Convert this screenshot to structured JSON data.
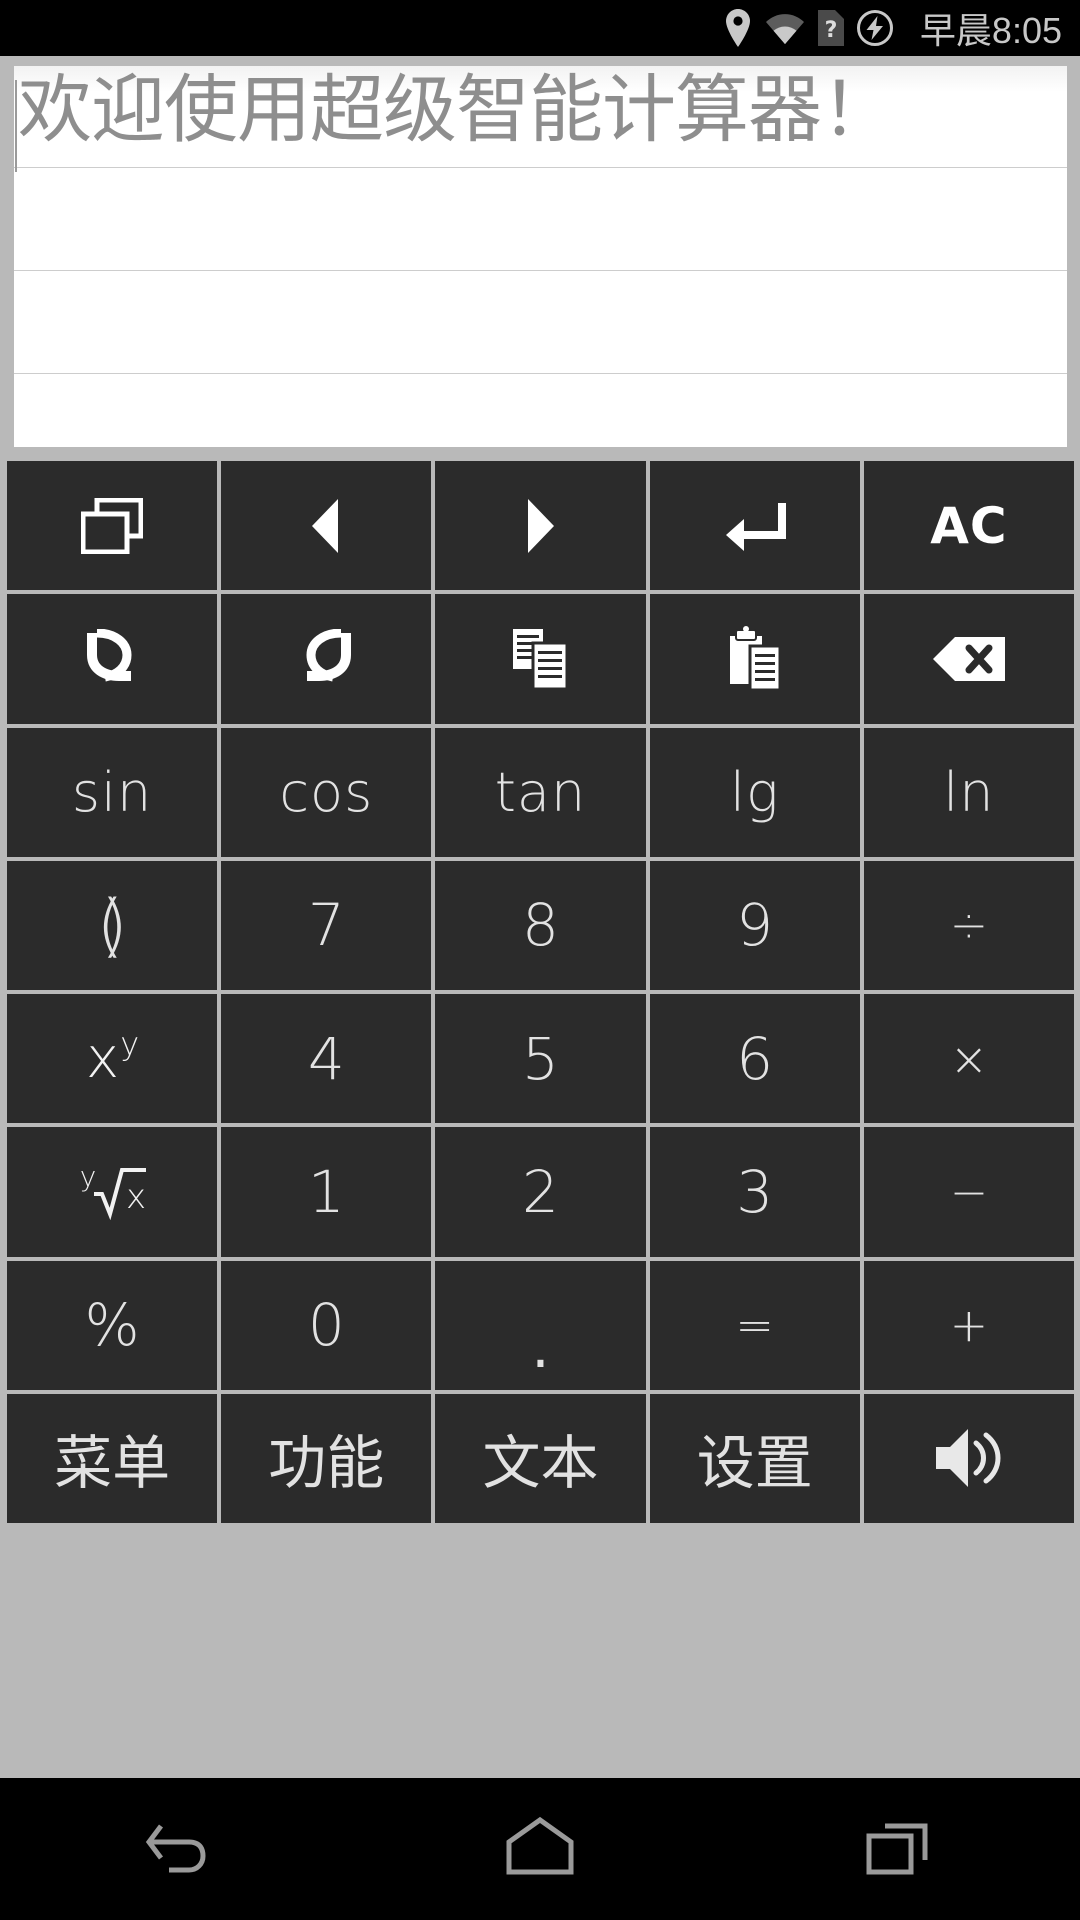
{
  "status_bar": {
    "time": "早晨8:05",
    "icons": [
      "location-pin-icon",
      "wifi-icon",
      "sim-card-question-icon",
      "no-charge-icon"
    ]
  },
  "display": {
    "text": "欢迎使用超级智能计算器！",
    "line_count": 4
  },
  "keypad": {
    "rows": [
      [
        {
          "name": "multi-window",
          "type": "icon",
          "icon": "windows-icon",
          "label": ""
        },
        {
          "name": "cursor-left",
          "type": "icon",
          "icon": "arrow-left-icon",
          "label": ""
        },
        {
          "name": "cursor-right",
          "type": "icon",
          "icon": "arrow-right-icon",
          "label": ""
        },
        {
          "name": "enter",
          "type": "icon",
          "icon": "enter-return-icon",
          "label": ""
        },
        {
          "name": "all-clear",
          "type": "text",
          "icon": "",
          "label": "AC"
        }
      ],
      [
        {
          "name": "undo",
          "type": "icon",
          "icon": "undo-icon",
          "label": ""
        },
        {
          "name": "redo",
          "type": "icon",
          "icon": "redo-icon",
          "label": ""
        },
        {
          "name": "copy",
          "type": "icon",
          "icon": "copy-icon",
          "label": ""
        },
        {
          "name": "paste",
          "type": "icon",
          "icon": "paste-icon",
          "label": ""
        },
        {
          "name": "backspace",
          "type": "icon",
          "icon": "backspace-icon",
          "label": ""
        }
      ],
      [
        {
          "name": "sin",
          "type": "text",
          "icon": "",
          "label": "sin"
        },
        {
          "name": "cos",
          "type": "text",
          "icon": "",
          "label": "cos"
        },
        {
          "name": "tan",
          "type": "text",
          "icon": "",
          "label": "tan"
        },
        {
          "name": "lg",
          "type": "text",
          "icon": "",
          "label": "lg"
        },
        {
          "name": "ln",
          "type": "text",
          "icon": "",
          "label": "ln"
        }
      ],
      [
        {
          "name": "parentheses",
          "type": "paren",
          "icon": "",
          "label": "()"
        },
        {
          "name": "digit-7",
          "type": "num",
          "icon": "",
          "label": "7"
        },
        {
          "name": "digit-8",
          "type": "num",
          "icon": "",
          "label": "8"
        },
        {
          "name": "digit-9",
          "type": "num",
          "icon": "",
          "label": "9"
        },
        {
          "name": "divide",
          "type": "op",
          "icon": "",
          "label": "÷"
        }
      ],
      [
        {
          "name": "power",
          "type": "power",
          "icon": "",
          "label": "x",
          "sup": "y"
        },
        {
          "name": "digit-4",
          "type": "num",
          "icon": "",
          "label": "4"
        },
        {
          "name": "digit-5",
          "type": "num",
          "icon": "",
          "label": "5"
        },
        {
          "name": "digit-6",
          "type": "num",
          "icon": "",
          "label": "6"
        },
        {
          "name": "multiply",
          "type": "op",
          "icon": "",
          "label": "×"
        }
      ],
      [
        {
          "name": "nth-root",
          "type": "root",
          "icon": "",
          "label": "x",
          "idx": "y"
        },
        {
          "name": "digit-1",
          "type": "num",
          "icon": "",
          "label": "1"
        },
        {
          "name": "digit-2",
          "type": "num",
          "icon": "",
          "label": "2"
        },
        {
          "name": "digit-3",
          "type": "num",
          "icon": "",
          "label": "3"
        },
        {
          "name": "minus",
          "type": "op",
          "icon": "",
          "label": "−"
        }
      ],
      [
        {
          "name": "percent",
          "type": "num",
          "icon": "",
          "label": "%"
        },
        {
          "name": "digit-0",
          "type": "num",
          "icon": "",
          "label": "0"
        },
        {
          "name": "decimal-point",
          "type": "dot",
          "icon": "",
          "label": "."
        },
        {
          "name": "equals",
          "type": "op",
          "icon": "",
          "label": "="
        },
        {
          "name": "plus",
          "type": "op",
          "icon": "",
          "label": "+"
        }
      ],
      [
        {
          "name": "menu",
          "type": "cn",
          "icon": "",
          "label": "菜单"
        },
        {
          "name": "function",
          "type": "cn",
          "icon": "",
          "label": "功能"
        },
        {
          "name": "text",
          "type": "cn",
          "icon": "",
          "label": "文本"
        },
        {
          "name": "settings",
          "type": "cn",
          "icon": "",
          "label": "设置"
        },
        {
          "name": "sound",
          "type": "icon",
          "icon": "speaker-icon",
          "label": ""
        }
      ]
    ]
  },
  "nav_bar": {
    "buttons": [
      {
        "name": "nav-back",
        "icon": "back-icon"
      },
      {
        "name": "nav-home",
        "icon": "home-icon"
      },
      {
        "name": "nav-recents",
        "icon": "recents-icon"
      }
    ]
  },
  "colors": {
    "key_bg": "#2b2b2b",
    "panel_bg": "#b9b9b9",
    "display_bg": "#ffffff",
    "display_text": "#8e8e8e",
    "key_text": "#e2e2e2",
    "status_bg": "#000000",
    "status_text": "#c8c8c8"
  }
}
